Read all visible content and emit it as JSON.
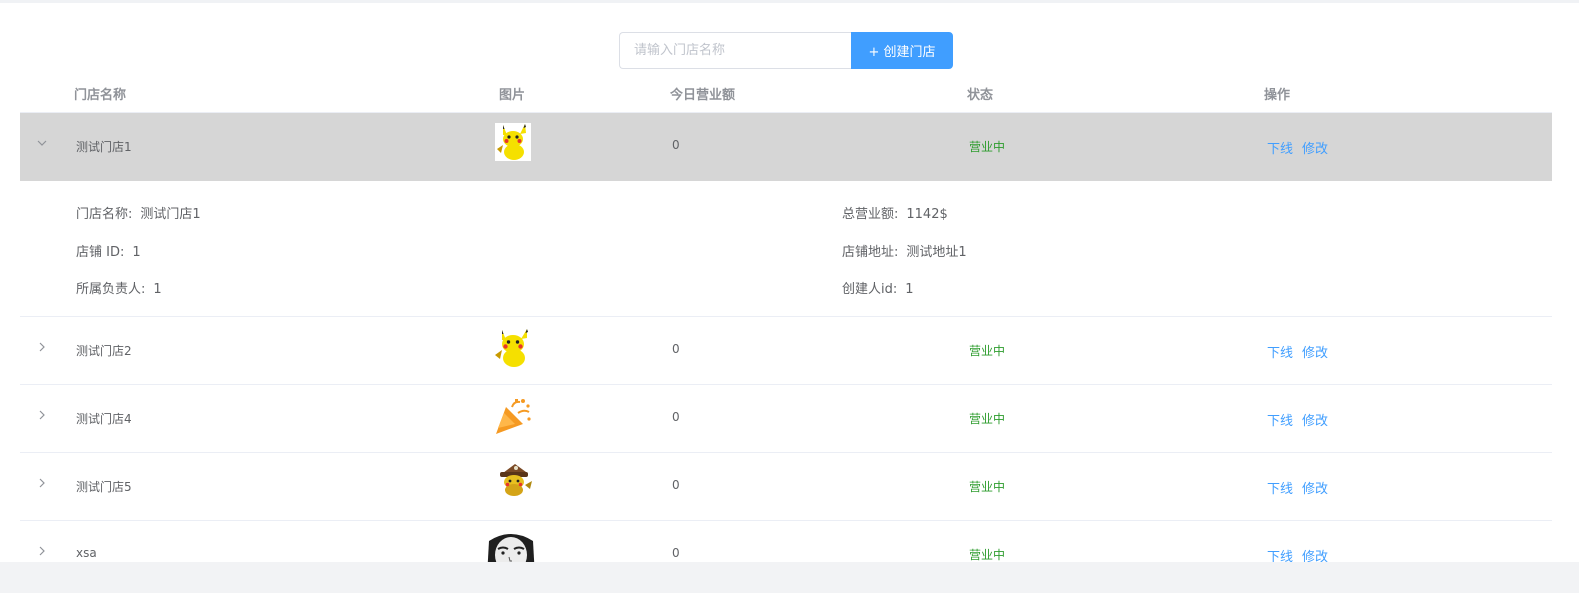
{
  "search": {
    "placeholder": "请输入门店名称",
    "value": ""
  },
  "create_button": {
    "label": "+ 创建门店"
  },
  "columns": {
    "name": "门店名称",
    "image": "图片",
    "revenue": "今日营业额",
    "status": "状态",
    "actions": "操作"
  },
  "rows": [
    {
      "name": "测试门店1",
      "revenue": "0",
      "status": "营业中",
      "offline": "下线",
      "edit": "修改",
      "expanded": true,
      "image": "pikachu"
    },
    {
      "name": "测试门店2",
      "revenue": "0",
      "status": "营业中",
      "offline": "下线",
      "edit": "修改",
      "expanded": false,
      "image": "pikachu"
    },
    {
      "name": "测试门店4",
      "revenue": "0",
      "status": "营业中",
      "offline": "下线",
      "edit": "修改",
      "expanded": false,
      "image": "party-popper"
    },
    {
      "name": "测试门店5",
      "revenue": "0",
      "status": "营业中",
      "offline": "下线",
      "edit": "修改",
      "expanded": false,
      "image": "pikachu-hat"
    },
    {
      "name": "xsa",
      "revenue": "0",
      "status": "营业中",
      "offline": "下线",
      "edit": "修改",
      "expanded": false,
      "image": "meme-face"
    }
  ],
  "detail": {
    "name_label": "门店名称:",
    "name_value": "测试门店1",
    "id_label": "店铺 ID:",
    "id_value": "1",
    "owner_label": "所属负责人:",
    "owner_value": "1",
    "total_label": "总营业额:",
    "total_value": "1142$",
    "address_label": "店铺地址:",
    "address_value": "测试地址1",
    "creator_label": "创建人id:",
    "creator_value": "1"
  },
  "colors": {
    "primary": "#409eff",
    "status_green": "#2d9c2d",
    "expanded_row_bg": "#d6d6d6"
  },
  "icons": {
    "collapse": "chevron-down-icon",
    "expand": "chevron-right-icon"
  }
}
